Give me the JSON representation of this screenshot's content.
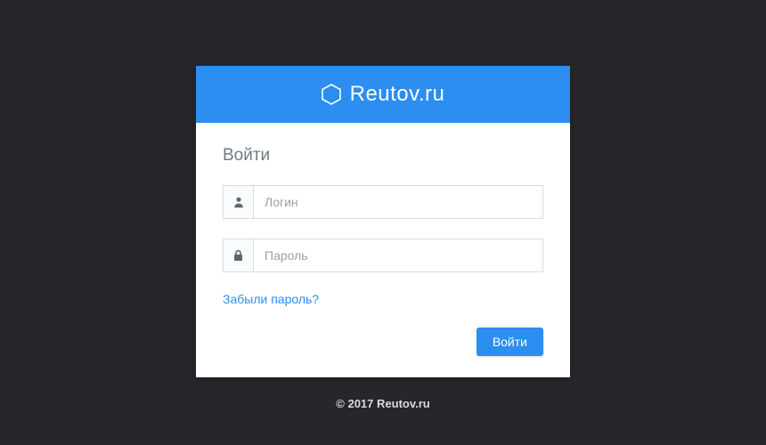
{
  "brand": {
    "name": "Reutov.ru",
    "accent": "#2b8ef0"
  },
  "form": {
    "title": "Войти",
    "login": {
      "placeholder": "Логин",
      "value": ""
    },
    "password": {
      "placeholder": "Пароль",
      "value": ""
    },
    "forgot_label": "Забыли пароль?",
    "submit_label": "Войти"
  },
  "footer": {
    "copyright": "© 2017 Reutov.ru"
  }
}
